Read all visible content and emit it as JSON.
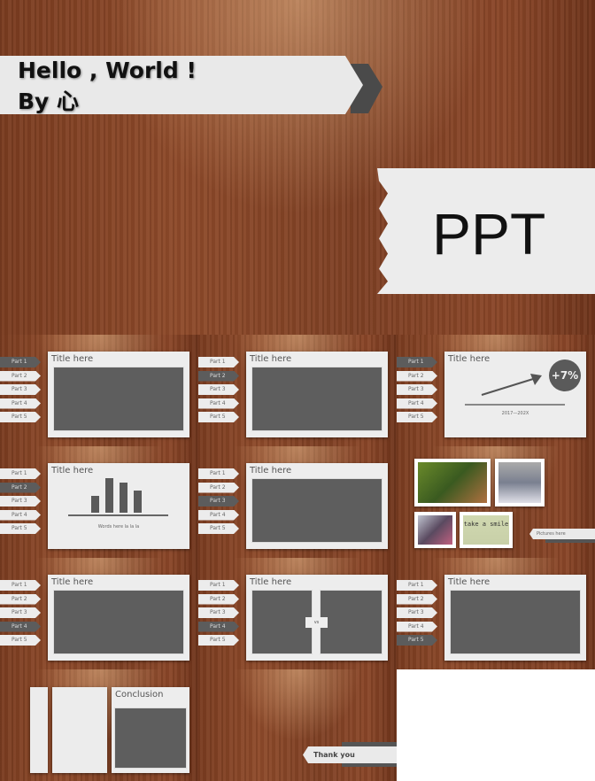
{
  "cover": {
    "title_line1": "Hello , World !",
    "title_line2": "By 心",
    "ppt_label": "PPT"
  },
  "parts": [
    "Part 1",
    "Part 2",
    "Part 3",
    "Part 4",
    "Part 5"
  ],
  "slides": [
    {
      "type": "box",
      "title": "Title here",
      "active": 1
    },
    {
      "type": "box",
      "title": "Title here",
      "active": 2
    },
    {
      "type": "growth",
      "title": "Title here",
      "active": 1,
      "badge": "+7%",
      "caption": "2017—202X"
    },
    {
      "type": "bars",
      "title": "Title here",
      "active": 2,
      "caption": "Words here la la la",
      "bars": [
        2,
        4,
        3.5,
        2.6
      ]
    },
    {
      "type": "box",
      "title": "Title here",
      "active": 3
    },
    {
      "type": "photos",
      "caption": "Pictures here",
      "note_text": "take a smile"
    },
    {
      "type": "box",
      "title": "Title here",
      "active": 4
    },
    {
      "type": "vs",
      "title": "Title here",
      "active": 4,
      "vs_label": "vs"
    },
    {
      "type": "box",
      "title": "Title here",
      "active": 5
    },
    {
      "type": "conclusion",
      "title": "Conclusion"
    },
    {
      "type": "thanks",
      "label": "Thank  you"
    }
  ],
  "colors": {
    "wood": "#8a4628",
    "panel": "#ededed",
    "dark": "#5e5e5e"
  }
}
